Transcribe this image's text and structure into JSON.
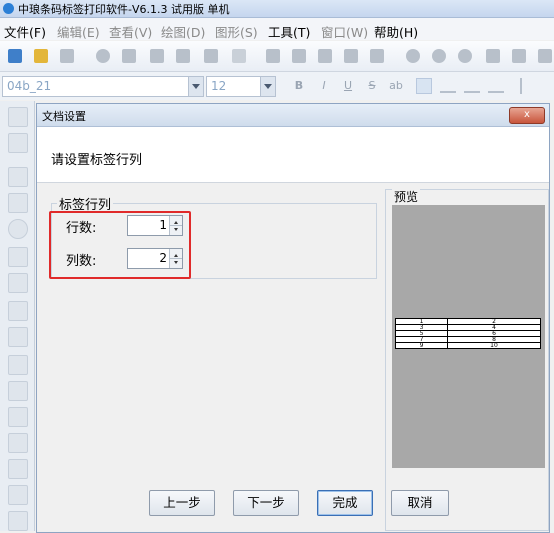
{
  "app": {
    "title": "中琅条码标签打印软件-V6.1.3 试用版 单机"
  },
  "menu": [
    {
      "label": "文件(F)",
      "enabled": true
    },
    {
      "label": "编辑(E)",
      "enabled": false
    },
    {
      "label": "查看(V)",
      "enabled": false
    },
    {
      "label": "绘图(D)",
      "enabled": false
    },
    {
      "label": "图形(S)",
      "enabled": false
    },
    {
      "label": "工具(T)",
      "enabled": true
    },
    {
      "label": "窗口(W)",
      "enabled": false
    },
    {
      "label": "帮助(H)",
      "enabled": true
    }
  ],
  "fontbar": {
    "font_name": "04b_21",
    "font_size": "12",
    "bold": "B",
    "italic": "I",
    "underline": "U",
    "strike": "S",
    "sub": "ab"
  },
  "dialog": {
    "title": "文档设置",
    "close_label": "x",
    "header": "请设置标签行列",
    "group_label": "标签行列",
    "rows_label": "行数:",
    "rows_value": "1",
    "cols_label": "列数:",
    "cols_value": "2",
    "preview_label": "预览",
    "preview_cells": [
      [
        "1",
        "2"
      ],
      [
        "3",
        "4"
      ],
      [
        "5",
        "6"
      ],
      [
        "7",
        "8"
      ],
      [
        "9",
        "10"
      ]
    ],
    "buttons": {
      "prev": "上一步",
      "next": "下一步",
      "finish": "完成",
      "cancel": "取消"
    }
  },
  "colors": {
    "highlight": "#e02a2a",
    "preview_bg": "#a8a8a8"
  }
}
